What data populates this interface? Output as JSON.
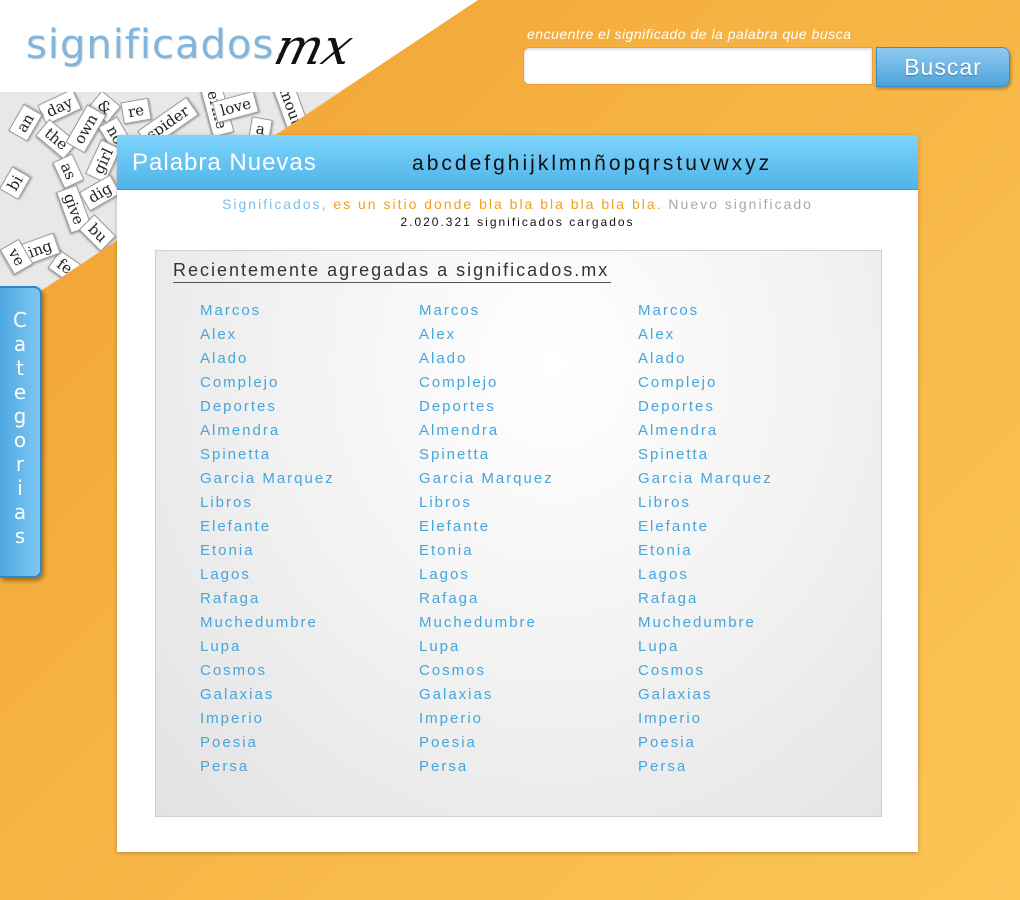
{
  "header": {
    "logo_text": "significados.",
    "logo_suffix": "mx",
    "tagline": "encuentre el significado de la palabra que busca",
    "search": {
      "value": "",
      "placeholder": "",
      "button_label": "Buscar"
    }
  },
  "collage_words": [
    "day",
    "&",
    "re",
    "ferme",
    "love",
    "mouth",
    "the",
    "an",
    "own",
    "no",
    "spider",
    "a",
    "as",
    "girl",
    "dig",
    "fear",
    "ing",
    "give",
    "bu",
    "ve",
    "bi"
  ],
  "sidebar": {
    "letters": [
      "C",
      "a",
      "t",
      "e",
      "g",
      "o",
      "r",
      "i",
      "a",
      "s"
    ]
  },
  "panel": {
    "title": "Palabra Nuevas",
    "alphabet": [
      "a",
      "b",
      "c",
      "d",
      "e",
      "f",
      "g",
      "h",
      "i",
      "j",
      "k",
      "l",
      "m",
      "n",
      "ñ",
      "o",
      "p",
      "q",
      "r",
      "s",
      "t",
      "u",
      "v",
      "w",
      "x",
      "y",
      "z"
    ],
    "intro": {
      "brand": "Significados",
      "desc": ", es un sitio donde bla bla bla bla bla bla.",
      "new_link": "Nuevo significado"
    },
    "count": "2.020.321 significados cargados",
    "recent": {
      "title": "Recientemente agregadas a significados.mx",
      "columns": [
        [
          "Marcos",
          "Alex",
          "Alado",
          "Complejo",
          "Deportes",
          "Almendra",
          "Spinetta",
          "Garcia Marquez",
          "Libros",
          "Elefante",
          "Etonia",
          "Lagos",
          "Rafaga",
          "Muchedumbre",
          "Lupa",
          "Cosmos",
          "Galaxias",
          "Imperio",
          "Poesia",
          "Persa"
        ],
        [
          "Marcos",
          "Alex",
          "Alado",
          "Complejo",
          "Deportes",
          "Almendra",
          "Spinetta",
          "Garcia Marquez",
          "Libros",
          "Elefante",
          "Etonia",
          "Lagos",
          "Rafaga",
          "Muchedumbre",
          "Lupa",
          "Cosmos",
          "Galaxias",
          "Imperio",
          "Poesia",
          "Persa"
        ],
        [
          "Marcos",
          "Alex",
          "Alado",
          "Complejo",
          "Deportes",
          "Almendra",
          "Spinetta",
          "Garcia Marquez",
          "Libros",
          "Elefante",
          "Etonia",
          "Lagos",
          "Rafaga",
          "Muchedumbre",
          "Lupa",
          "Cosmos",
          "Galaxias",
          "Imperio",
          "Poesia",
          "Persa"
        ]
      ]
    }
  },
  "colors": {
    "accent_blue": "#45a6dd",
    "orange": "#f0a020",
    "header_blue": "#5bbdf0"
  }
}
